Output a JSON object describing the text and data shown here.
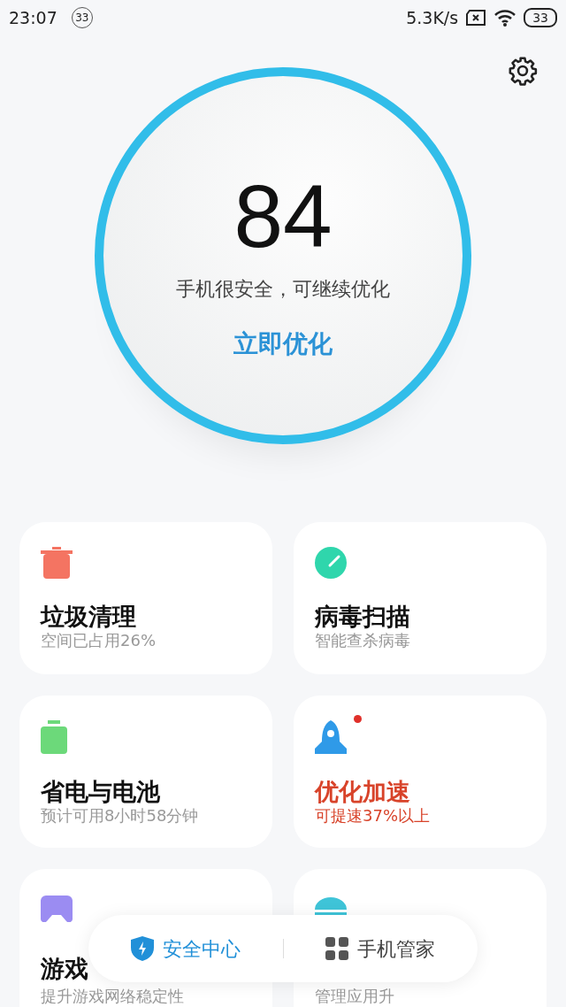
{
  "status_bar": {
    "time": "23:07",
    "notification_count": "33",
    "speed": "5.3K/s",
    "battery": "33"
  },
  "score": {
    "value": "84",
    "status": "手机很安全，可继续优化",
    "action": "立即优化"
  },
  "cards": [
    {
      "kind": "trash",
      "color": "#f47462",
      "title": "垃圾清理",
      "subtitle": "空间已占用26%",
      "alert": false
    },
    {
      "kind": "scan",
      "color": "#2fd6ac",
      "title": "病毒扫描",
      "subtitle": "智能查杀病毒",
      "alert": false
    },
    {
      "kind": "battery",
      "color": "#6cd97a",
      "title": "省电与电池",
      "subtitle": "预计可用8小时58分钟",
      "alert": false
    },
    {
      "kind": "rocket",
      "color": "#2f9ae8",
      "title": "优化加速",
      "subtitle": "可提速37%以上",
      "alert": true
    },
    {
      "kind": "gamepad",
      "color": "#9b8cf2",
      "title": "游戏",
      "subtitle": "提升游戏网络稳定性",
      "alert": false
    },
    {
      "kind": "android",
      "color": "#3fc4d8",
      "subtitle": "管理应用升",
      "alert": false
    }
  ],
  "bottom_nav": [
    {
      "kind": "shield",
      "label": "安全中心",
      "selected": true
    },
    {
      "kind": "grid",
      "label": "手机管家",
      "selected": false
    }
  ]
}
